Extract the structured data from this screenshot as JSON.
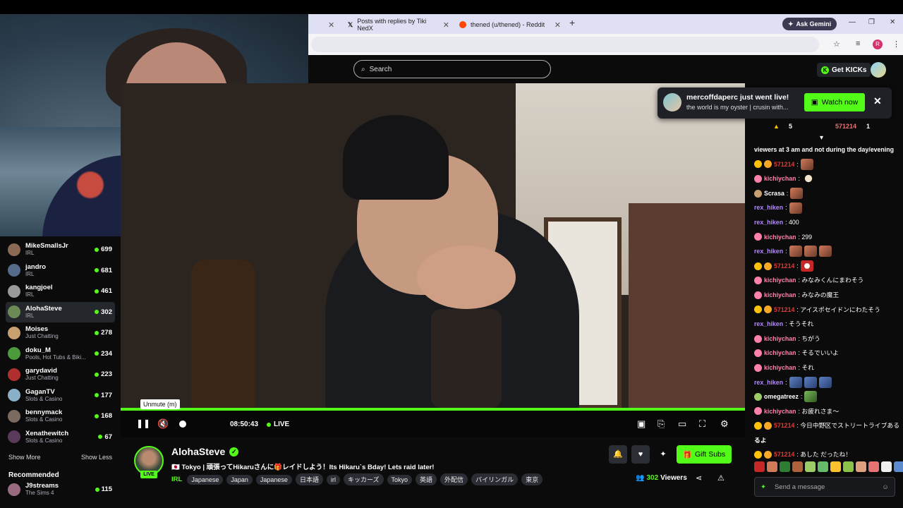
{
  "browser": {
    "tabs": [
      {
        "label": "Posts with replies by Tiki NedX"
      },
      {
        "label": "thened (u/thened) - Reddit"
      }
    ],
    "gemini_label": "Ask Gemini",
    "new_tab_symbol": "+",
    "window_controls": [
      "—",
      "❐",
      "✕"
    ],
    "profile_initial": "R"
  },
  "header": {
    "search_placeholder": "Search",
    "get_kicks_label": "Get KICKs"
  },
  "notification": {
    "title": "mercoffdaperc just went live!",
    "subtitle": "the world is my oyster | crusin with...",
    "watch_label": "Watch now",
    "close_symbol": "✕"
  },
  "sidebar": {
    "channels": [
      {
        "name": "MikeSmallsJr",
        "category": "IRL",
        "viewers": "699",
        "color": "#8a6a55"
      },
      {
        "name": "jandro",
        "category": "IRL",
        "viewers": "681",
        "color": "#556b8a"
      },
      {
        "name": "kangjoel",
        "category": "IRL",
        "viewers": "461",
        "color": "#9a9a9a"
      },
      {
        "name": "AlohaSteve",
        "category": "IRL",
        "viewers": "302",
        "color": "#6b8a55",
        "active": true
      },
      {
        "name": "Moises",
        "category": "Just Chatting",
        "viewers": "278",
        "color": "#c8a070"
      },
      {
        "name": "doku_M",
        "category": "Pools, Hot Tubs & Biki...",
        "viewers": "234",
        "color": "#4c9a3a"
      },
      {
        "name": "garydavid",
        "category": "Just Chatting",
        "viewers": "223",
        "color": "#b03030"
      },
      {
        "name": "GaganTV",
        "category": "Slots & Casino",
        "viewers": "177",
        "color": "#8ab0c8"
      },
      {
        "name": "bennymack",
        "category": "Slots & Casino",
        "viewers": "168",
        "color": "#7a6a60"
      },
      {
        "name": "Xenathewitch",
        "category": "Slots & Casino",
        "viewers": "67",
        "color": "#5a3a5a"
      },
      {
        "name": "J9streams",
        "category": "The Sims 4",
        "viewers": "115",
        "color": "#9a6a80"
      }
    ],
    "show_more": "Show More",
    "show_less": "Show Less",
    "recommended": "Recommended"
  },
  "player": {
    "tooltip": "Unmute (m)",
    "time": "08:50:43",
    "live_label": "LIVE",
    "volume_level_fraction": 0
  },
  "stream": {
    "name": "AlohaSteve",
    "live_badge": "LIVE",
    "title": "🇯🇵 Tokyo | 頑張ってHikaruさんに🎁レイドしよう！Its Hikaru`s Bday! Lets raid later!",
    "category": "IRL",
    "tags": [
      "Japanese",
      "Japan",
      "Japanese",
      "日本語",
      "irl",
      "キッカーズ",
      "Tokyo",
      "英語",
      "外配信",
      "バイリンガル",
      "東京"
    ],
    "viewers_count": "302",
    "viewers_label": "Viewers",
    "gift_subs_label": "Gift Subs"
  },
  "chat": {
    "pinned_top": {
      "left": "5",
      "user": "571214",
      "right": "1"
    },
    "messages": [
      {
        "user": "",
        "text": "viewers at 3 am and not during the day/evening",
        "color": "#ffffff",
        "emotes": 0
      },
      {
        "user": "571214",
        "text": ":",
        "color": "#e53935",
        "emotes": 1
      },
      {
        "user": "kichiychan",
        "text": ":",
        "color": "#ff80ab",
        "emotes": 1
      },
      {
        "user": "Scrasa",
        "text": ":",
        "color": "#ffffff",
        "emotes": 1
      },
      {
        "user": "rex_hiken",
        "text": ":",
        "color": "#b388ff",
        "emotes": 1
      },
      {
        "user": "rex_hiken",
        "text": ": 400",
        "color": "#b388ff",
        "emotes": 0
      },
      {
        "user": "kichiychan",
        "text": ": 299",
        "color": "#ff80ab",
        "emotes": 0
      },
      {
        "user": "rex_hiken",
        "text": ":",
        "color": "#b388ff",
        "emotes": 3
      },
      {
        "user": "571214",
        "text": ":",
        "color": "#e53935",
        "emotes": 1
      },
      {
        "user": "kichiychan",
        "text": ": みなみくんにまわそう",
        "color": "#ff80ab",
        "emotes": 0
      },
      {
        "user": "kichiychan",
        "text": ": みなみの魔王",
        "color": "#ff80ab",
        "emotes": 0
      },
      {
        "user": "571214",
        "text": ": アイスポセイドンにわたそう",
        "color": "#e53935",
        "emotes": 0
      },
      {
        "user": "rex_hiken",
        "text": ": そうそれ",
        "color": "#b388ff",
        "emotes": 0
      },
      {
        "user": "kichiychan",
        "text": ": ちがう",
        "color": "#ff80ab",
        "emotes": 0
      },
      {
        "user": "kichiychan",
        "text": ": そるでいいよ",
        "color": "#ff80ab",
        "emotes": 0
      },
      {
        "user": "kichiychan",
        "text": ": それ",
        "color": "#ff80ab",
        "emotes": 0
      },
      {
        "user": "rex_hiken",
        "text": ":",
        "color": "#b388ff",
        "emotes": 3
      },
      {
        "user": "omegatreez",
        "text": ":",
        "color": "#ffffff",
        "emotes": 1
      },
      {
        "user": "kichiychan",
        "text": ": お疲れさま〜",
        "color": "#ff80ab",
        "emotes": 0
      },
      {
        "user": "571214",
        "text": ": 今日中野区でストリートライブある",
        "color": "#e53935",
        "emotes": 0
      },
      {
        "user": "",
        "text": "るよ",
        "color": "#ffffff",
        "emotes": 0
      },
      {
        "user": "571214",
        "text": ": あした だったね！",
        "color": "#e53935",
        "emotes": 0
      }
    ],
    "input_placeholder": "Send a message"
  },
  "colors": {
    "accent": "#53fc18",
    "background": "#0b0b0c"
  }
}
